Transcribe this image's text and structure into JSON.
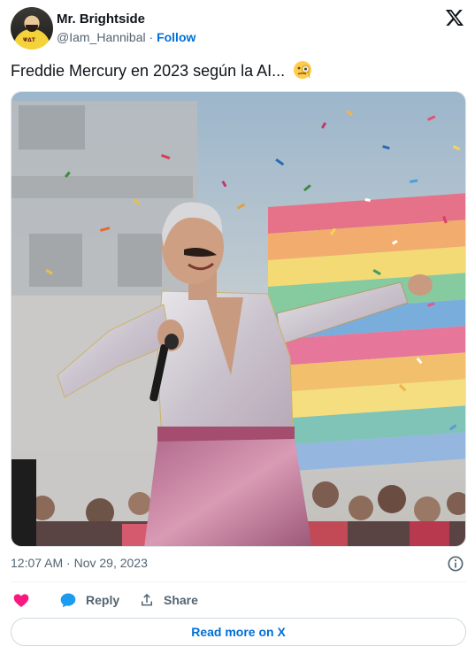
{
  "author": {
    "name": "Mr. Brightside",
    "handle": "@Iam_Hannibal",
    "separator": "·",
    "follow_label": "Follow",
    "avatar_tag": "ΨΔΤ"
  },
  "platform_icon": "x-logo-icon",
  "tweet": {
    "text": "Freddie Mercury en 2023 según la AI...",
    "emoji_icon": "monocle-face-emoji"
  },
  "media": {
    "kind": "photo",
    "subject_icon": "performer-with-microphone-image"
  },
  "meta": {
    "timestamp": "12:07 AM · Nov 29, 2023",
    "info_icon": "info-icon"
  },
  "actions": {
    "like_icon": "heart-icon",
    "reply_label": "Reply",
    "share_label": "Share"
  },
  "read_more_label": "Read more on X",
  "colors": {
    "link": "#006fd6",
    "text": "#0f1419",
    "secondary": "#536471",
    "heart": "#f91880",
    "reply": "#1d9bf0"
  }
}
